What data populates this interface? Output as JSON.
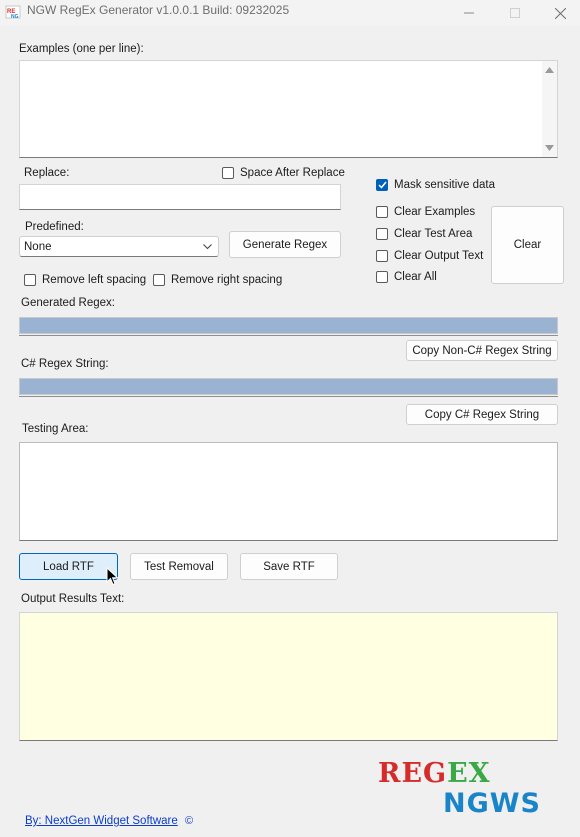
{
  "window": {
    "title": "NGW RegEx Generator v1.0.0.1 Build: 09232025"
  },
  "examples": {
    "label": "Examples (one per line):",
    "value": ""
  },
  "replace": {
    "label": "Replace:",
    "value": "",
    "space_after_label": "Space After Replace",
    "space_after_checked": false
  },
  "predefined": {
    "label": "Predefined:",
    "selected": "None"
  },
  "buttons": {
    "generate": "Generate Regex",
    "clear": "Clear",
    "copy_non_csharp": "Copy Non-C# Regex String",
    "copy_csharp": "Copy C# Regex String",
    "load_rtf": "Load RTF",
    "test_removal": "Test Removal",
    "save_rtf": "Save RTF"
  },
  "options": {
    "mask_sensitive": {
      "label": "Mask sensitive data",
      "checked": true
    },
    "clear_examples": {
      "label": "Clear Examples",
      "checked": false
    },
    "clear_test_area": {
      "label": "Clear Test Area",
      "checked": false
    },
    "clear_output_text": {
      "label": "Clear Output Text",
      "checked": false
    },
    "clear_all": {
      "label": "Clear All",
      "checked": false
    },
    "remove_left_spacing": {
      "label": "Remove left spacing",
      "checked": false
    },
    "remove_right_spacing": {
      "label": "Remove right spacing",
      "checked": false
    }
  },
  "generated_regex": {
    "label": "Generated Regex:",
    "value": ""
  },
  "csharp_regex": {
    "label": "C# Regex String:",
    "value": ""
  },
  "testing_area": {
    "label": "Testing Area:",
    "value": ""
  },
  "output_results": {
    "label": "Output Results Text:",
    "value": ""
  },
  "footer": {
    "link_text": "By: NextGen Widget Software",
    "copyright_symbol": "©",
    "logo_line1_a": "REG",
    "logo_line1_b": "EX",
    "logo_line2": "NGWS"
  },
  "colors": {
    "accent": "#005fb8",
    "regex_field": "#9bb3d2",
    "output_bg": "#ffffe1",
    "logo_red": "#d62b2b",
    "logo_green": "#3aa845",
    "logo_blue": "#1a84c9"
  }
}
